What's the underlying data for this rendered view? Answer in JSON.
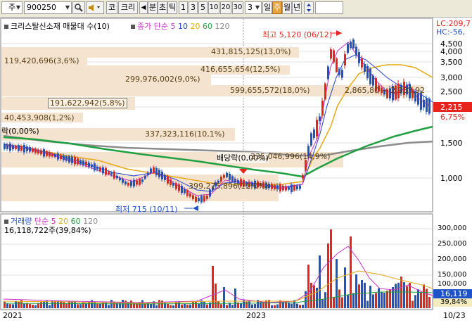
{
  "toolbar": {
    "market": "주",
    "code": "900250",
    "btn_code": "코",
    "btn_kri": "크리",
    "btn_bun": "분",
    "btn_cho": "초",
    "btn_tick": "틱",
    "periods": [
      "1",
      "3",
      "5",
      "10",
      "20",
      "30"
    ],
    "count": "3",
    "btn_day": "일",
    "btn_week": "주",
    "btn_month": "월",
    "btn_year": "년"
  },
  "price_panel": {
    "title": "크리스탈신소재 매물대 수(10)",
    "ma_label": "종가 단순",
    "ma_periods": [
      "5",
      "10",
      "20",
      "60",
      "120"
    ],
    "lc": "LC:209,7",
    "hc": "HC:-56,",
    "high_label": "최고 5,120 (06/12)",
    "low_label": "최저 715 (10/11)",
    "event_label": "배당락(0,00%)",
    "event_label2": "락(0,00%)",
    "range_label": "2,865,80 ~ 2,933,92",
    "current_price": "2,215",
    "current_change": "6,75%",
    "price_axis": [
      "4,500",
      "4,000",
      "3,500",
      "3,000",
      "2,500",
      "2,000",
      "1,500",
      "1,000"
    ],
    "volume_profile": [
      {
        "label": "431,815,125(13,0%)"
      },
      {
        "label": "119,420,696(3,6%)"
      },
      {
        "label": "416,655,654(12,5%)"
      },
      {
        "label": "299,976,002(9,0%)"
      },
      {
        "label": "599,655,572(18,0%)"
      },
      {
        "label": "191,622,942(5,8%)"
      },
      {
        "label": "40,453,908(1,2%)"
      },
      {
        "label": "337,323,116(10,1%)"
      },
      {
        "label": "335,046,996(14,9%)"
      },
      {
        "label": "399,275,896(12,0%)"
      }
    ]
  },
  "volume_panel": {
    "title": "거래량",
    "ma_label": "단순",
    "ma_periods": [
      "5",
      "20",
      "60",
      "120"
    ],
    "value": "16,118,722주(39,84%)",
    "axis": [
      "300,000",
      "250,000",
      "200,000",
      "150,000",
      "100,000",
      "50,000"
    ],
    "current_volume": "16,119",
    "current_pct": "39,84%"
  },
  "x_axis": {
    "labels": [
      "2021",
      "2023",
      "10/23"
    ]
  },
  "colors": {
    "up": "#e8231c",
    "down": "#1e52c8",
    "ma5": "#c832c8",
    "ma10": "#2040d0",
    "ma20": "#e8a816",
    "ma60": "#20a040",
    "ma120": "#8c8c8c",
    "profile": "#f4e4cf"
  }
}
